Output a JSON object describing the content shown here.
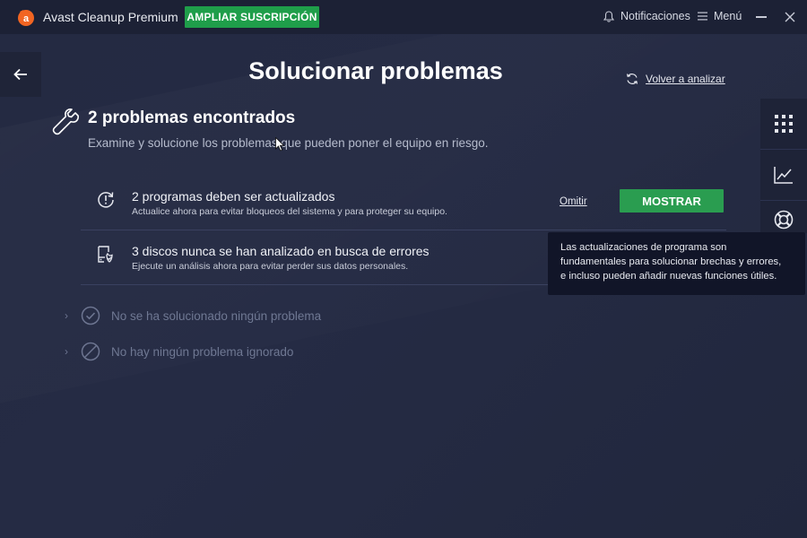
{
  "titlebar": {
    "app_title": "Avast Cleanup Premium",
    "upgrade_label": "AMPLIAR SUSCRIPCIÓN",
    "notifications_label": "Notificaciones",
    "menu_label": "Menú"
  },
  "header": {
    "page_title": "Solucionar problemas",
    "rescan_label": "Volver a analizar"
  },
  "summary": {
    "title": "2 problemas encontrados",
    "subtitle": "Examine y solucione los problemas que pueden poner el equipo en riesgo."
  },
  "issues": [
    {
      "title": "2 programas deben ser actualizados",
      "description": "Actualice ahora para evitar bloqueos del sistema y para proteger su equipo.",
      "icon": "update-icon",
      "skip_label": "Omitir",
      "action_label": "MOSTRAR"
    },
    {
      "title": "3 discos nunca se han analizado en busca de errores",
      "description": "Ejecute un análisis ahora para evitar perder sus datos personales.",
      "icon": "disk-check-icon"
    }
  ],
  "sections": [
    {
      "label": "No se ha solucionado ningún problema",
      "icon": "check-circle-icon"
    },
    {
      "label": "No hay ningún problema ignorado",
      "icon": "blocked-circle-icon"
    }
  ],
  "tooltip": {
    "lines": [
      "Las actualizaciones de programa son",
      "fundamentales para solucionar brechas y errores,",
      "e incluso pueden añadir nuevas funciones útiles."
    ]
  },
  "side_panel": [
    "grid-icon",
    "chart-icon",
    "lifebuoy-icon"
  ],
  "colors": {
    "background": "#242a42",
    "titlebar": "#1c2135",
    "accent_green": "#1f9e4a",
    "logo_orange": "#f26522",
    "tooltip_bg": "#111528"
  }
}
